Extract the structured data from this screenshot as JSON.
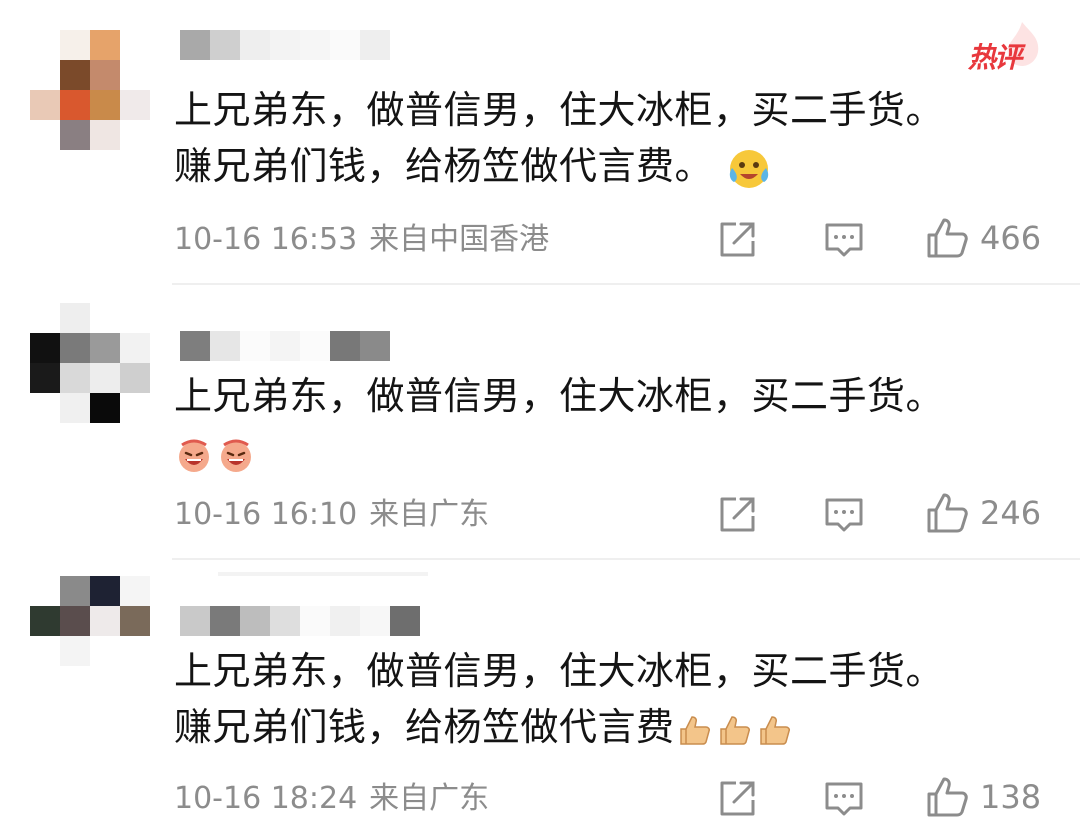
{
  "badge": {
    "hot_label": "热评"
  },
  "comments": [
    {
      "text_lines": [
        "上兄弟东，做普信男，住大冰柜，买二手货。",
        "赚兄弟们钱，给杨笠做代言费。"
      ],
      "emoji": "crying-laughing-emoji",
      "time": "10-16 16:53",
      "location": "来自中国香港",
      "likes": "466"
    },
    {
      "text_lines": [
        "上兄弟东，做普信男，住大冰柜，买二手货。"
      ],
      "emoji": "laughing-face-emoji",
      "time": "10-16 16:10",
      "location": "来自广东",
      "likes": "246"
    },
    {
      "text_lines": [
        "上兄弟东，做普信男，住大冰柜，买二手货。",
        "赚兄弟们钱，给杨笠做代言费"
      ],
      "emoji": "thumbs-up-emoji",
      "time": "10-16 18:24",
      "location": "来自广东",
      "likes": "138"
    }
  ],
  "colors": {
    "text": "#141414",
    "meta": "#8c8c8c",
    "hot_badge": "#e8383d",
    "divider": "#efefef"
  },
  "icons": [
    "share-icon",
    "comment-icon",
    "like-icon"
  ]
}
